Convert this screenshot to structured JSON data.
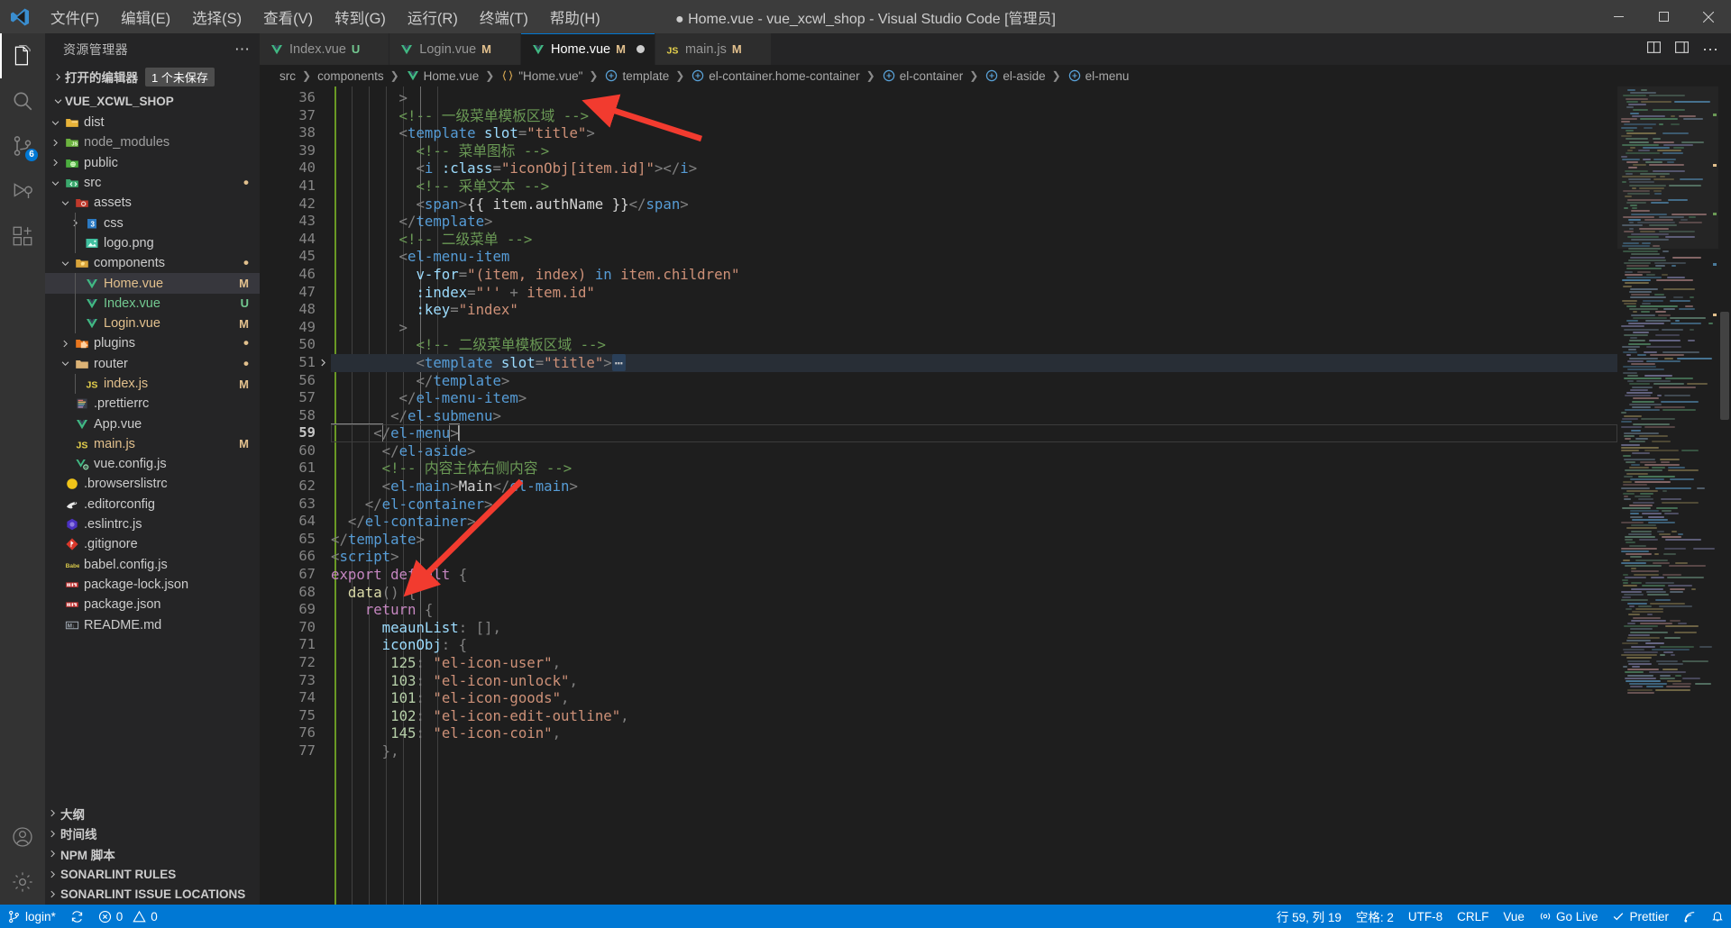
{
  "titlebar": {
    "logo_icon": "vscode-logo-icon",
    "menus": [
      "文件(F)",
      "编辑(E)",
      "选择(S)",
      "查看(V)",
      "转到(G)",
      "运行(R)",
      "终端(T)",
      "帮助(H)"
    ],
    "title": "● Home.vue - vue_xcwl_shop - Visual Studio Code [管理员]",
    "minimize_icon": "minimize-icon",
    "maximize_icon": "maximize-icon",
    "close_icon": "close-icon"
  },
  "activitybar": {
    "items": [
      {
        "name": "explorer",
        "icon": "files-icon",
        "badge": ""
      },
      {
        "name": "search",
        "icon": "search-icon",
        "badge": ""
      },
      {
        "name": "source-control",
        "icon": "source-control-icon",
        "badge": "6"
      },
      {
        "name": "run-and-debug",
        "icon": "debug-icon",
        "badge": ""
      },
      {
        "name": "extensions",
        "icon": "extensions-icon",
        "badge": ""
      }
    ],
    "bottom": [
      {
        "name": "accounts",
        "icon": "account-icon"
      },
      {
        "name": "manage",
        "icon": "gear-icon"
      }
    ]
  },
  "sidebar": {
    "title": "资源管理器",
    "more_icon": "ellipsis-icon",
    "open_editors": {
      "label": "打开的编辑器",
      "badge": "1 个未保存"
    },
    "project": "VUE_XCWL_SHOP",
    "tree": [
      {
        "label": "dist",
        "depth": 1,
        "twisty": "down",
        "icon": "folder-dist",
        "color": "#cccccc",
        "status": ""
      },
      {
        "label": "node_modules",
        "depth": 1,
        "twisty": "right",
        "icon": "folder-node",
        "color": "#a0a0a0",
        "status": ""
      },
      {
        "label": "public",
        "depth": 1,
        "twisty": "right",
        "icon": "folder-public",
        "color": "#cccccc",
        "status": ""
      },
      {
        "label": "src",
        "depth": 1,
        "twisty": "down",
        "icon": "folder-src",
        "color": "#cccccc",
        "status": "•"
      },
      {
        "label": "assets",
        "depth": 2,
        "twisty": "down",
        "icon": "folder-assets",
        "color": "#cccccc",
        "status": ""
      },
      {
        "label": "css",
        "depth": 3,
        "twisty": "right",
        "icon": "folder-css",
        "color": "#cccccc",
        "status": ""
      },
      {
        "label": "logo.png",
        "depth": 3,
        "twisty": "none",
        "icon": "image-icon",
        "color": "#cccccc",
        "status": ""
      },
      {
        "label": "components",
        "depth": 2,
        "twisty": "down",
        "icon": "folder-components",
        "color": "#cccccc",
        "status": "•"
      },
      {
        "label": "Home.vue",
        "depth": 3,
        "twisty": "none",
        "icon": "vue-icon",
        "color": "#e2c08d",
        "status": "M",
        "selected": true
      },
      {
        "label": "Index.vue",
        "depth": 3,
        "twisty": "none",
        "icon": "vue-icon",
        "color": "#73c991",
        "status": "U"
      },
      {
        "label": "Login.vue",
        "depth": 3,
        "twisty": "none",
        "icon": "vue-icon",
        "color": "#e2c08d",
        "status": "M"
      },
      {
        "label": "plugins",
        "depth": 2,
        "twisty": "right",
        "icon": "folder-plugins",
        "color": "#cccccc",
        "status": "•"
      },
      {
        "label": "router",
        "depth": 2,
        "twisty": "down",
        "icon": "folder-plain",
        "color": "#cccccc",
        "status": "•"
      },
      {
        "label": "index.js",
        "depth": 3,
        "twisty": "none",
        "icon": "js-icon",
        "color": "#e2c08d",
        "status": "M"
      },
      {
        "label": ".prettierrc",
        "depth": 2,
        "twisty": "none",
        "icon": "prettier-icon",
        "color": "#cccccc",
        "status": ""
      },
      {
        "label": "App.vue",
        "depth": 2,
        "twisty": "none",
        "icon": "vue-icon",
        "color": "#cccccc",
        "status": ""
      },
      {
        "label": "main.js",
        "depth": 2,
        "twisty": "none",
        "icon": "js-icon",
        "color": "#e2c08d",
        "status": "M"
      },
      {
        "label": "vue.config.js",
        "depth": 2,
        "twisty": "none",
        "icon": "vue-config-icon",
        "color": "#cccccc",
        "status": ""
      },
      {
        "label": ".browserslistrc",
        "depth": 1,
        "twisty": "none",
        "icon": "browserslist-icon",
        "color": "#cccccc",
        "status": ""
      },
      {
        "label": ".editorconfig",
        "depth": 1,
        "twisty": "none",
        "icon": "editorconfig-icon",
        "color": "#cccccc",
        "status": ""
      },
      {
        "label": ".eslintrc.js",
        "depth": 1,
        "twisty": "none",
        "icon": "eslint-icon",
        "color": "#cccccc",
        "status": ""
      },
      {
        "label": ".gitignore",
        "depth": 1,
        "twisty": "none",
        "icon": "git-icon",
        "color": "#cccccc",
        "status": ""
      },
      {
        "label": "babel.config.js",
        "depth": 1,
        "twisty": "none",
        "icon": "babel-icon",
        "color": "#cccccc",
        "status": ""
      },
      {
        "label": "package-lock.json",
        "depth": 1,
        "twisty": "none",
        "icon": "npm-icon",
        "color": "#cccccc",
        "status": ""
      },
      {
        "label": "package.json",
        "depth": 1,
        "twisty": "none",
        "icon": "npm-icon",
        "color": "#cccccc",
        "status": ""
      },
      {
        "label": "README.md",
        "depth": 1,
        "twisty": "none",
        "icon": "markdown-icon",
        "color": "#cccccc",
        "status": ""
      }
    ],
    "bottom_sections": [
      "大纲",
      "时间线",
      "NPM 脚本",
      "SONARLINT RULES",
      "SONARLINT ISSUE LOCATIONS"
    ]
  },
  "tabs": [
    {
      "label": "Index.vue",
      "icon": "vue-icon",
      "status": "U",
      "active": false,
      "dirty": false
    },
    {
      "label": "Login.vue",
      "icon": "vue-icon",
      "status": "M",
      "active": false,
      "dirty": false
    },
    {
      "label": "Home.vue",
      "icon": "vue-icon",
      "status": "M",
      "active": true,
      "dirty": true
    },
    {
      "label": "main.js",
      "icon": "js-icon",
      "status": "M",
      "active": false,
      "dirty": false
    }
  ],
  "tab_actions": [
    {
      "name": "split-editor-icon",
      "glyph": "▯"
    },
    {
      "name": "layout-icon",
      "glyph": "▤"
    },
    {
      "name": "more-actions-icon",
      "glyph": "⋯"
    }
  ],
  "breadcrumbs": [
    {
      "label": "src",
      "icon": ""
    },
    {
      "label": "components",
      "icon": ""
    },
    {
      "label": "Home.vue",
      "icon": "vue-icon"
    },
    {
      "label": "\"Home.vue\"",
      "icon": "braces-icon"
    },
    {
      "label": "template",
      "icon": "symbol-icon"
    },
    {
      "label": "el-container.home-container",
      "icon": "symbol-icon"
    },
    {
      "label": "el-container",
      "icon": "symbol-icon"
    },
    {
      "label": "el-aside",
      "icon": "symbol-icon"
    },
    {
      "label": "el-menu",
      "icon": "symbol-icon"
    }
  ],
  "code": {
    "first_line_top_partial": true,
    "lines": [
      {
        "no": "36",
        "fold": "",
        "indent": 10,
        "html": "<span class='tok-punc'>        &gt;</span>"
      },
      {
        "no": "37",
        "fold": "",
        "indent": 10,
        "html": "<span class='tok-com'>        &lt;!-- 一级菜单模板区域 --&gt;</span>"
      },
      {
        "no": "38",
        "fold": "",
        "indent": 10,
        "html": "<span class='tok-punc'>        &lt;</span><span class='tok-tag'>template</span> <span class='tok-attr'>slot</span><span class='tok-punc'>=</span><span class='tok-str'>\"title\"</span><span class='tok-punc'>&gt;</span>"
      },
      {
        "no": "39",
        "fold": "",
        "indent": 11,
        "html": "<span class='tok-com'>          &lt;!-- 菜单图标 --&gt;</span>"
      },
      {
        "no": "40",
        "fold": "",
        "indent": 11,
        "html": "<span class='tok-punc'>          &lt;</span><span class='tok-tag'>i</span> <span class='tok-attr'>:class</span><span class='tok-punc'>=</span><span class='tok-str'>\"iconObj[item.id]\"</span><span class='tok-punc'>&gt;&lt;/</span><span class='tok-tag'>i</span><span class='tok-punc'>&gt;</span>"
      },
      {
        "no": "41",
        "fold": "",
        "indent": 11,
        "html": "<span class='tok-com'>          &lt;!-- 采单文本 --&gt;</span>"
      },
      {
        "no": "42",
        "fold": "",
        "indent": 11,
        "html": "<span class='tok-punc'>          &lt;</span><span class='tok-tag'>span</span><span class='tok-punc'>&gt;</span><span class='tok-txt'>{{ item.authName }}</span><span class='tok-punc'>&lt;/</span><span class='tok-tag'>span</span><span class='tok-punc'>&gt;</span>"
      },
      {
        "no": "43",
        "fold": "",
        "indent": 10,
        "html": "<span class='tok-punc'>        &lt;/</span><span class='tok-tag'>template</span><span class='tok-punc'>&gt;</span>"
      },
      {
        "no": "44",
        "fold": "",
        "indent": 10,
        "html": "<span class='tok-com'>        &lt;!-- 二级菜单 --&gt;</span>"
      },
      {
        "no": "45",
        "fold": "",
        "indent": 10,
        "html": "<span class='tok-punc'>        &lt;</span><span class='tok-tag'>el-menu-item</span>"
      },
      {
        "no": "46",
        "fold": "",
        "indent": 11,
        "html": "          <span class='tok-attr'>v-for</span><span class='tok-punc'>=</span><span class='tok-str'>\"(item, index)</span> <span class='tok-kw2'>in</span> <span class='tok-str'>item.children\"</span>"
      },
      {
        "no": "47",
        "fold": "",
        "indent": 11,
        "html": "          <span class='tok-attr'>:index</span><span class='tok-punc'>=</span><span class='tok-str'>\"''</span> <span class='tok-punc'>+</span> <span class='tok-str'>item.id\"</span>"
      },
      {
        "no": "48",
        "fold": "",
        "indent": 11,
        "html": "          <span class='tok-attr'>:key</span><span class='tok-punc'>=</span><span class='tok-str'>\"index\"</span>"
      },
      {
        "no": "49",
        "fold": "",
        "indent": 10,
        "html": "<span class='tok-punc'>        &gt;</span>"
      },
      {
        "no": "50",
        "fold": "",
        "indent": 11,
        "html": "<span class='tok-com'>          &lt;!-- 二级菜单模板区域 --&gt;</span>"
      },
      {
        "no": "51",
        "fold": "right",
        "indent": 11,
        "hl": true,
        "html": "<span class='tok-punc'>          &lt;</span><span class='tok-tag'>template</span> <span class='tok-attr'>slot</span><span class='tok-punc'>=</span><span class='tok-str'>\"title\"</span><span class='tok-punc'>&gt;</span><span class='tok-fold'>⋯</span>"
      },
      {
        "no": "56",
        "fold": "",
        "indent": 11,
        "html": "<span class='tok-punc'>          &lt;/</span><span class='tok-tag'>template</span><span class='tok-punc'>&gt;</span>"
      },
      {
        "no": "57",
        "fold": "",
        "indent": 10,
        "html": "<span class='tok-punc'>        &lt;/</span><span class='tok-tag'>el-menu-item</span><span class='tok-punc'>&gt;</span>"
      },
      {
        "no": "58",
        "fold": "",
        "indent": 9,
        "html": "<span class='tok-punc'>       &lt;/</span><span class='tok-tag'>el-submenu</span><span class='tok-punc'>&gt;</span>"
      },
      {
        "no": "59",
        "fold": "",
        "indent": 8,
        "cur": true,
        "html": "<span class='tok-punc tok-brk'>     &lt;</span><span class='tok-punc'>/</span><span class='tok-tag'>el-menu</span><span class='tok-punc tok-brk'>&gt;</span><span class='caret'></span>"
      },
      {
        "no": "60",
        "fold": "",
        "indent": 7,
        "html": "<span class='tok-punc'>      &lt;/</span><span class='tok-tag'>el-aside</span><span class='tok-punc'>&gt;</span>"
      },
      {
        "no": "61",
        "fold": "",
        "indent": 7,
        "html": "<span class='tok-com'>      &lt;!-- 内容主体右侧内容 --&gt;</span>"
      },
      {
        "no": "62",
        "fold": "",
        "indent": 7,
        "html": "<span class='tok-punc'>      &lt;</span><span class='tok-tag'>el-main</span><span class='tok-punc'>&gt;</span><span class='tok-mst'>Main</span><span class='tok-punc'>&lt;/</span><span class='tok-tag'>el-main</span><span class='tok-punc'>&gt;</span>"
      },
      {
        "no": "63",
        "fold": "",
        "indent": 5,
        "html": "<span class='tok-punc'>    &lt;/</span><span class='tok-tag'>el-container</span><span class='tok-punc'>&gt;</span>"
      },
      {
        "no": "64",
        "fold": "",
        "indent": 3,
        "html": "<span class='tok-punc'>  &lt;/</span><span class='tok-tag'>el-container</span><span class='tok-punc'>&gt;</span>"
      },
      {
        "no": "65",
        "fold": "",
        "indent": 1,
        "html": "<span class='tok-punc'>&lt;/</span><span class='tok-tag'>template</span><span class='tok-punc'>&gt;</span>"
      },
      {
        "no": "66",
        "fold": "",
        "indent": 1,
        "html": "<span class='tok-punc'>&lt;</span><span class='tok-tag'>script</span><span class='tok-punc'>&gt;</span>"
      },
      {
        "no": "67",
        "fold": "",
        "indent": 1,
        "html": "<span class='tok-kw'>export default</span> <span class='tok-punc'>{</span>"
      },
      {
        "no": "68",
        "fold": "",
        "indent": 3,
        "html": "  <span class='tok-fn'>data</span><span class='tok-punc'>() {</span>"
      },
      {
        "no": "69",
        "fold": "",
        "indent": 5,
        "html": "    <span class='tok-kw'>return</span> <span class='tok-punc'>{</span>"
      },
      {
        "no": "70",
        "fold": "",
        "indent": 7,
        "html": "      <span class='tok-var'>meaunList</span><span class='tok-punc'>: [],</span>"
      },
      {
        "no": "71",
        "fold": "",
        "indent": 7,
        "html": "      <span class='tok-var'>iconObj</span><span class='tok-punc'>: {</span>"
      },
      {
        "no": "72",
        "fold": "",
        "indent": 8,
        "html": "       <span class='tok-num'>125</span><span class='tok-punc'>:</span> <span class='tok-str'>\"el-icon-user\"</span><span class='tok-punc'>,</span>"
      },
      {
        "no": "73",
        "fold": "",
        "indent": 8,
        "html": "       <span class='tok-num'>103</span><span class='tok-punc'>:</span> <span class='tok-str'>\"el-icon-unlock\"</span><span class='tok-punc'>,</span>"
      },
      {
        "no": "74",
        "fold": "",
        "indent": 8,
        "html": "       <span class='tok-num'>101</span><span class='tok-punc'>:</span> <span class='tok-str'>\"el-icon-goods\"</span><span class='tok-punc'>,</span>"
      },
      {
        "no": "75",
        "fold": "",
        "indent": 8,
        "html": "       <span class='tok-num'>102</span><span class='tok-punc'>:</span> <span class='tok-str'>\"el-icon-edit-outline\"</span><span class='tok-punc'>,</span>"
      },
      {
        "no": "76",
        "fold": "",
        "indent": 8,
        "html": "       <span class='tok-num'>145</span><span class='tok-punc'>:</span> <span class='tok-str'>\"el-icon-coin\"</span><span class='tok-punc'>,</span>"
      },
      {
        "no": "77",
        "fold": "",
        "indent": 7,
        "html": "      <span class='tok-punc'>},</span>"
      }
    ]
  },
  "statusbar": {
    "left": [
      {
        "name": "branch",
        "icon": "source-control-icon",
        "label": "login*"
      },
      {
        "name": "sync",
        "icon": "sync-icon",
        "label": ""
      },
      {
        "name": "problems",
        "icon": "error-warning-icon",
        "label": "0  0",
        "errors": "0",
        "warnings": "0"
      }
    ],
    "right": [
      {
        "name": "cursor-position",
        "label": "行 59, 列 19"
      },
      {
        "name": "indentation",
        "label": "空格: 2"
      },
      {
        "name": "encoding",
        "label": "UTF-8"
      },
      {
        "name": "eol",
        "label": "CRLF"
      },
      {
        "name": "language-mode",
        "label": "Vue"
      },
      {
        "name": "go-live",
        "label": "Go Live",
        "icon": "broadcast-icon"
      },
      {
        "name": "prettier",
        "label": "Prettier",
        "icon": "check-icon"
      },
      {
        "name": "sonarlint",
        "label": "",
        "icon": "sonarlint-icon"
      },
      {
        "name": "notifications",
        "label": "",
        "icon": "bell-icon"
      }
    ]
  },
  "annotations": {
    "arrow1": "red-arrow-pointing-to-iconObj-binding",
    "arrow2": "red-arrow-pointing-to-iconObj-declaration",
    "color": "#f23b2f"
  }
}
